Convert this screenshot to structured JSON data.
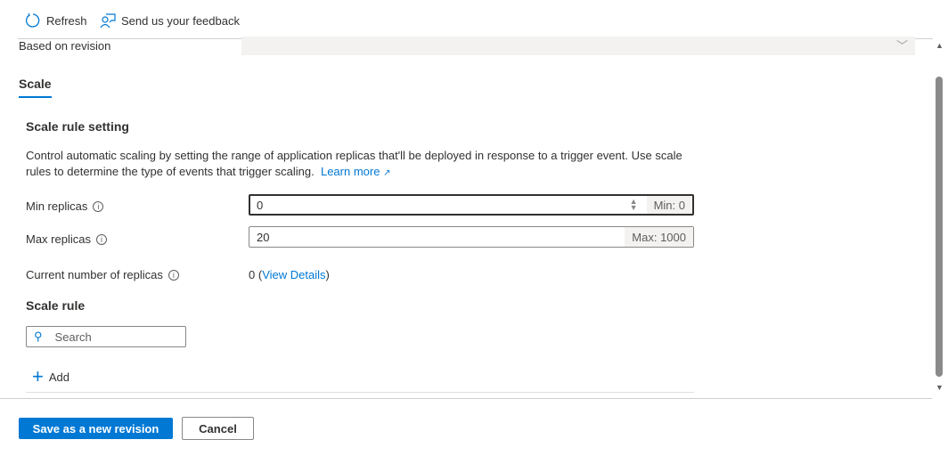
{
  "toolbar": {
    "refresh": "Refresh",
    "feedback": "Send us your feedback"
  },
  "revision": {
    "label": "Based on revision",
    "value": ""
  },
  "tabs": [
    {
      "label": "Scale",
      "active": true
    }
  ],
  "section": {
    "title": "Scale rule setting",
    "description": "Control automatic scaling by setting the range of application replicas that'll be deployed in response to a trigger event. Use scale rules to determine the type of events that trigger scaling.",
    "learn_more": "Learn more"
  },
  "min": {
    "label": "Min replicas",
    "value": "0",
    "suffix": "Min: 0"
  },
  "max": {
    "label": "Max replicas",
    "value": "20",
    "suffix": "Max: 1000"
  },
  "current": {
    "label": "Current number of replicas",
    "value": "0",
    "link": "View Details"
  },
  "rules": {
    "title": "Scale rule",
    "search_placeholder": "Search",
    "add": "Add"
  },
  "footer": {
    "save": "Save as a new revision",
    "cancel": "Cancel"
  },
  "colors": {
    "accent": "#0078d4"
  }
}
